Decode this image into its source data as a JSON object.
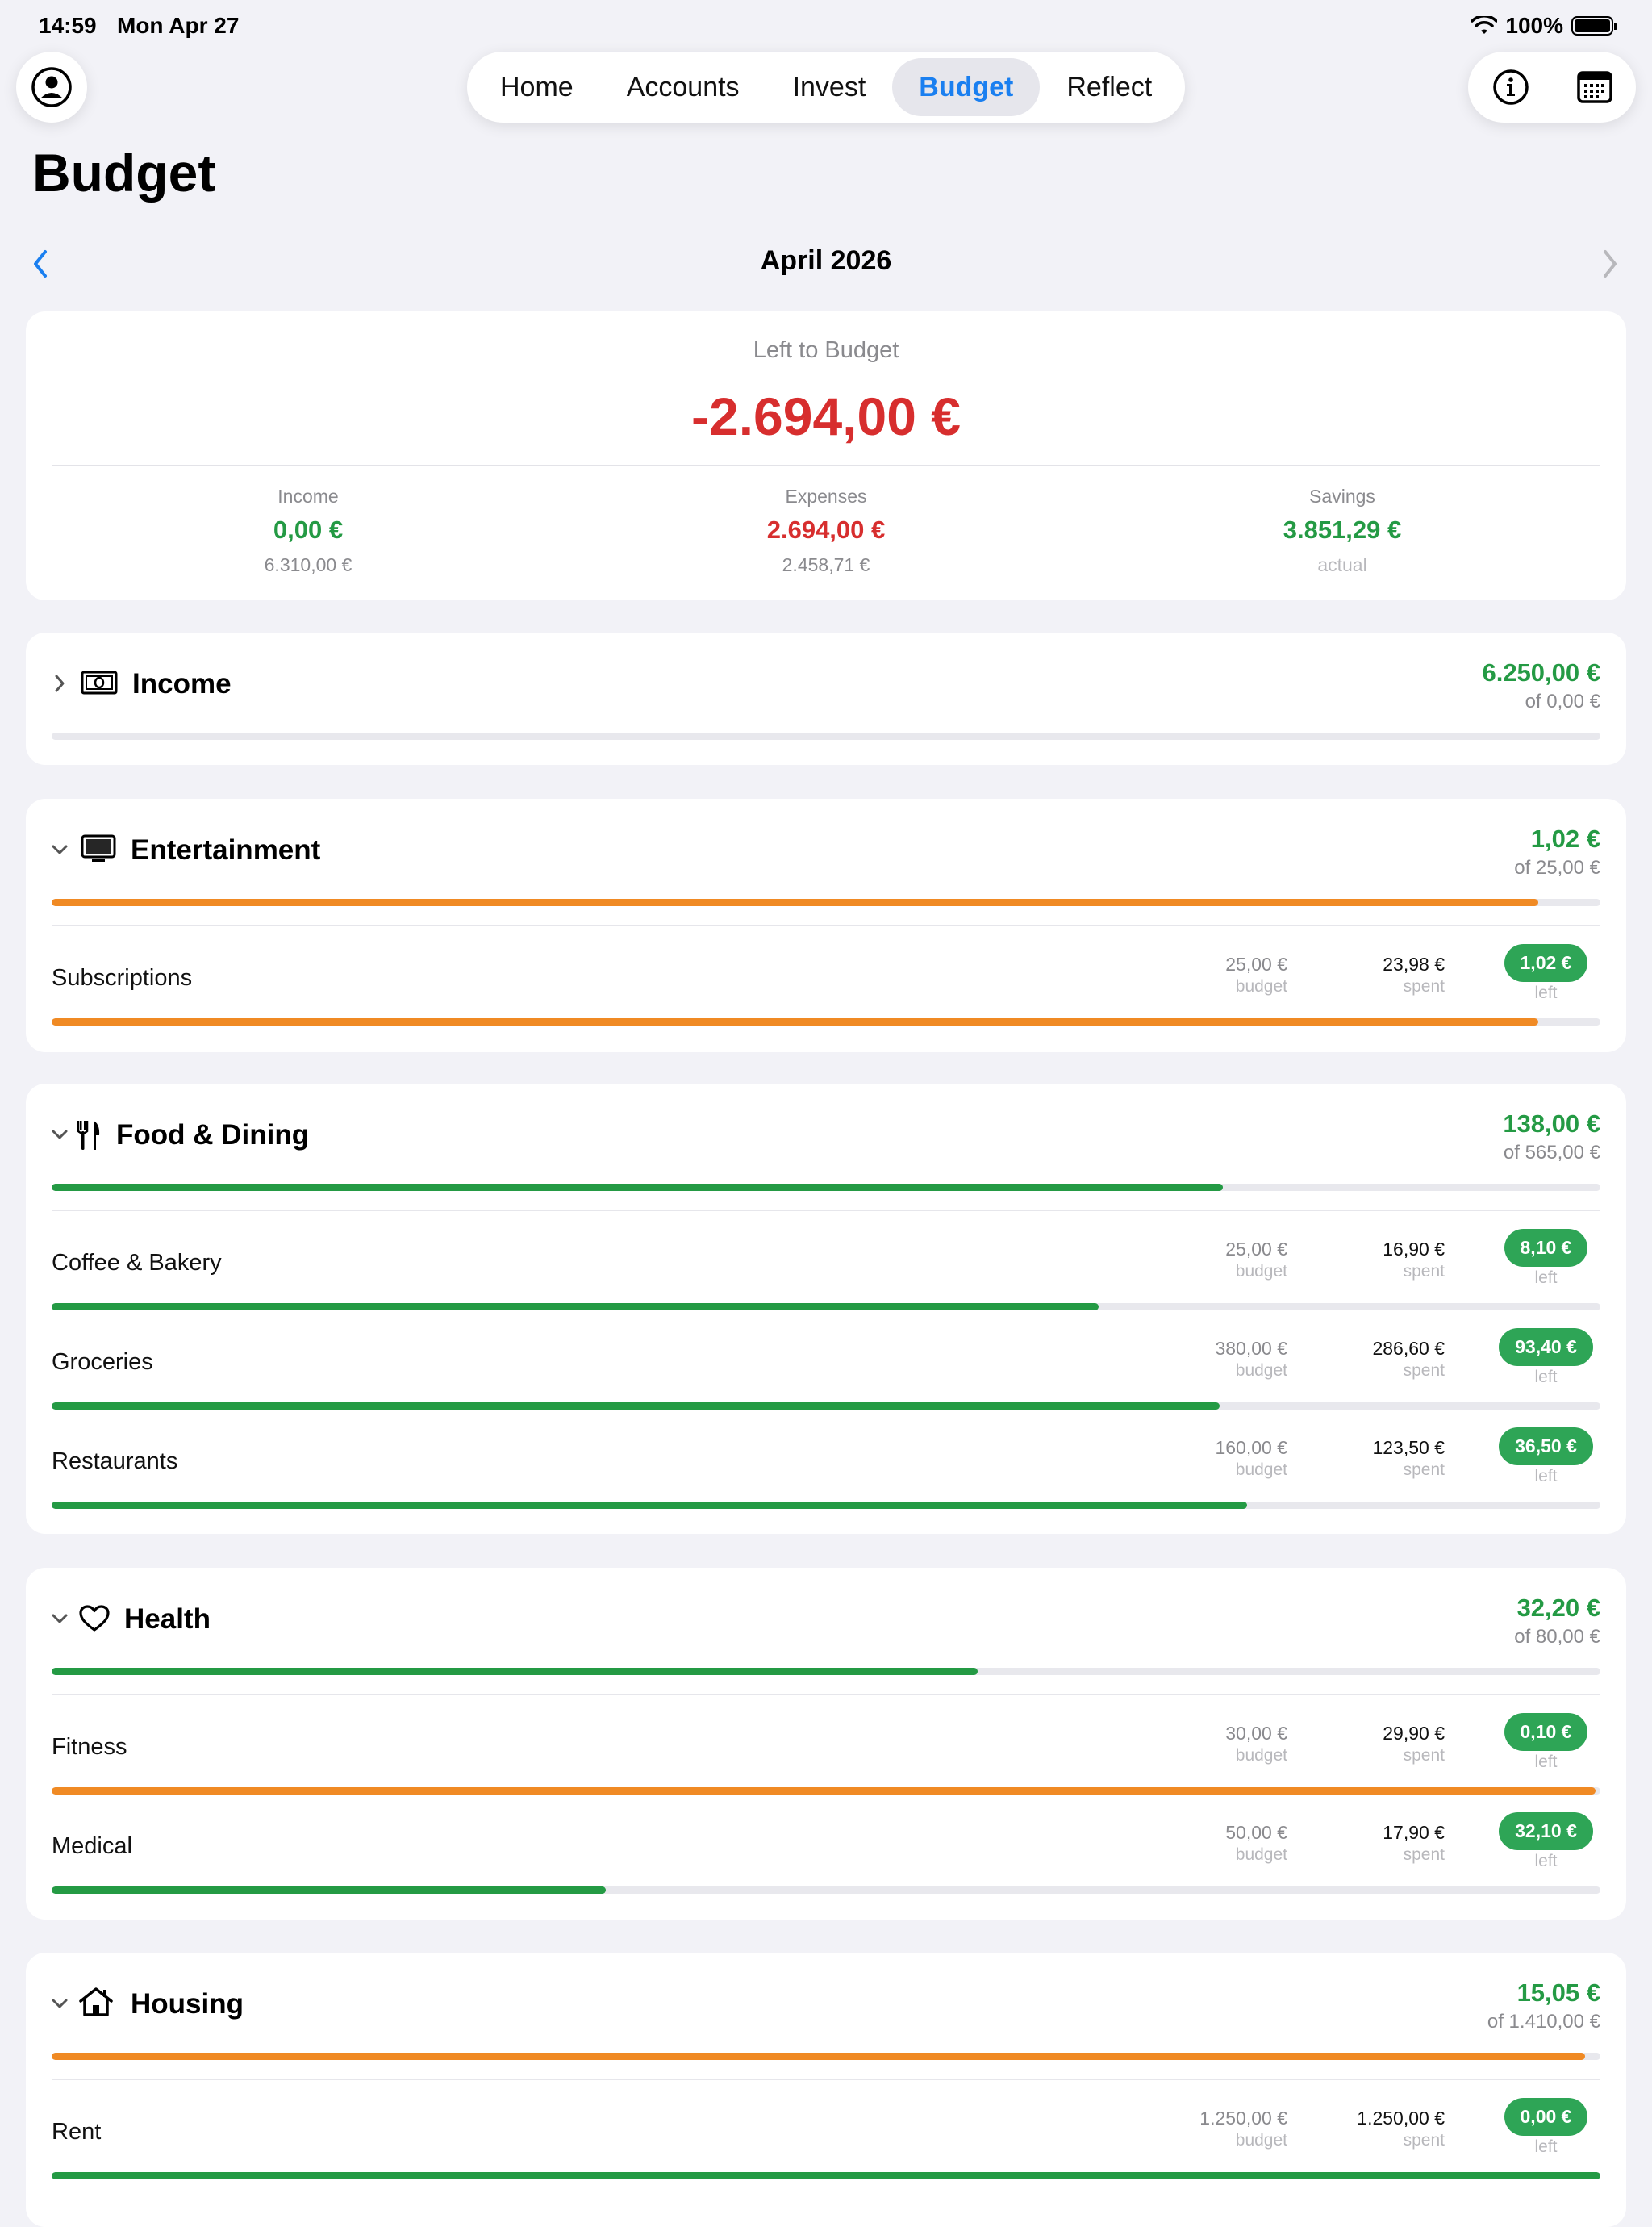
{
  "status": {
    "time": "14:59",
    "date": "Mon Apr 27",
    "battery": "100%"
  },
  "nav": {
    "tabs": [
      {
        "label": "Home"
      },
      {
        "label": "Accounts"
      },
      {
        "label": "Invest"
      },
      {
        "label": "Budget"
      },
      {
        "label": "Reflect"
      }
    ],
    "active": "Budget"
  },
  "page_title": "Budget",
  "month": "April 2026",
  "summary": {
    "label": "Left to Budget",
    "value": "-2.694,00 €",
    "income": {
      "label": "Income",
      "value": "0,00 €",
      "sub": "6.310,00 €"
    },
    "expenses": {
      "label": "Expenses",
      "value": "2.694,00 €",
      "sub": "2.458,71 €"
    },
    "savings": {
      "label": "Savings",
      "value": "3.851,29 €",
      "sub": "actual"
    }
  },
  "categories": [
    {
      "name": "Income",
      "icon": "banknote-icon",
      "amount": "6.250,00 €",
      "of": "of 0,00 €",
      "progress": 0
    },
    {
      "name": "Entertainment",
      "icon": "tv-icon",
      "amount": "1,02 €",
      "of": "of 25,00 €",
      "progress": 0.96,
      "items": [
        {
          "name": "Subscriptions",
          "budget": "25,00 €",
          "spent": "23,98 €",
          "left": "1,02 €",
          "progress": 0.96
        }
      ]
    },
    {
      "name": "Food & Dining",
      "icon": "fork-knife-icon",
      "amount": "138,00 €",
      "of": "of 565,00 €",
      "progress": 0.756,
      "items": [
        {
          "name": "Coffee & Bakery",
          "budget": "25,00 €",
          "spent": "16,90 €",
          "left": "8,10 €",
          "progress": 0.676
        },
        {
          "name": "Groceries",
          "budget": "380,00 €",
          "spent": "286,60 €",
          "left": "93,40 €",
          "progress": 0.754
        },
        {
          "name": "Restaurants",
          "budget": "160,00 €",
          "spent": "123,50 €",
          "left": "36,50 €",
          "progress": 0.772
        }
      ]
    },
    {
      "name": "Health",
      "icon": "heart-icon",
      "amount": "32,20 €",
      "of": "of 80,00 €",
      "progress": 0.598,
      "items": [
        {
          "name": "Fitness",
          "budget": "30,00 €",
          "spent": "29,90 €",
          "left": "0,10 €",
          "progress": 0.997
        },
        {
          "name": "Medical",
          "budget": "50,00 €",
          "spent": "17,90 €",
          "left": "32,10 €",
          "progress": 0.358
        }
      ]
    },
    {
      "name": "Housing",
      "icon": "house-icon",
      "amount": "15,05 €",
      "of": "of 1.410,00 €",
      "progress": 0.99,
      "items": [
        {
          "name": "Rent",
          "budget": "1.250,00 €",
          "spent": "1.250,00 €",
          "left": "0,00 €",
          "progress": 1.0
        }
      ]
    }
  ],
  "labels": {
    "budget": "budget",
    "spent": "spent",
    "left": "left"
  },
  "colors": {
    "accent": "#1a7ff0",
    "positive": "#249a44",
    "negative": "#d72e2e",
    "warning": "#f08a24"
  }
}
